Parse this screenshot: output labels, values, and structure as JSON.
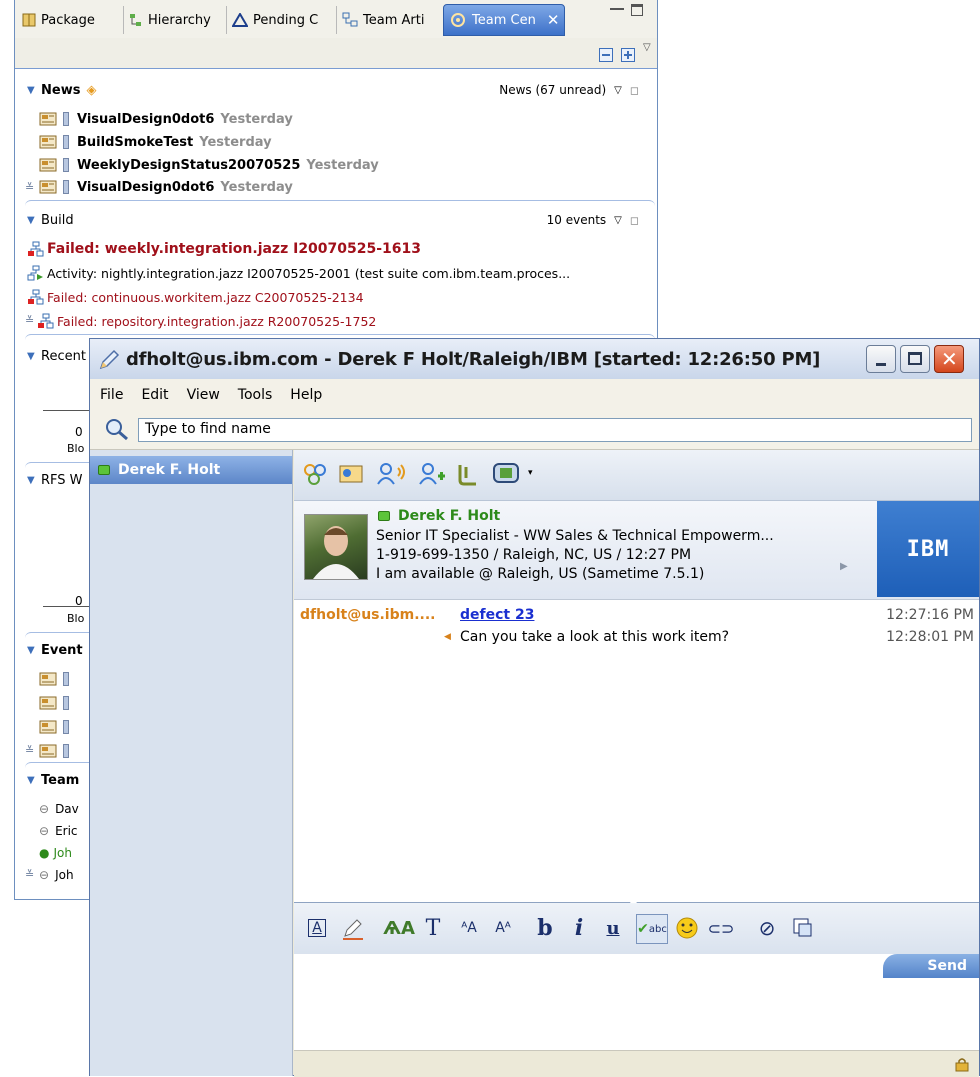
{
  "eclipse": {
    "tabs": [
      {
        "label": "Package"
      },
      {
        "label": "Hierarchy"
      },
      {
        "label": "Pending C"
      },
      {
        "label": "Team Arti"
      },
      {
        "label": "Team Cen",
        "active": true
      }
    ],
    "news": {
      "title": "News",
      "summary": "News (67 unread)",
      "items": [
        {
          "title": "VisualDesign0dot6",
          "when": "Yesterday"
        },
        {
          "title": "BuildSmokeTest",
          "when": "Yesterday"
        },
        {
          "title": "WeeklyDesignStatus20070525",
          "when": "Yesterday"
        },
        {
          "title": "VisualDesign0dot6",
          "when": "Yesterday"
        }
      ]
    },
    "build": {
      "title": "Build",
      "summary": "10 events",
      "items": [
        {
          "text": "Failed: weekly.integration.jazz I20070525-1613",
          "status": "failed",
          "bold": true
        },
        {
          "text": "Activity: nightly.integration.jazz I20070525-2001 (test suite com.ibm.team.proces...",
          "status": "activity"
        },
        {
          "text": "Failed: continuous.workitem.jazz C20070525-2134",
          "status": "failed"
        },
        {
          "text": "Failed: repository.integration.jazz R20070525-1752",
          "status": "failed"
        }
      ]
    },
    "recent": {
      "title": "Recent",
      "tick": "0",
      "axis": "Blo"
    },
    "rfs": {
      "title": "RFS W",
      "tick": "0",
      "axis": "Blo"
    },
    "events": {
      "title": "Event"
    },
    "team": {
      "title": "Team",
      "members": [
        "Dav",
        "Eric",
        "Joh",
        "Joh"
      ]
    }
  },
  "sametime": {
    "window_title": "dfholt@us.ibm.com - Derek F Holt/Raleigh/IBM [started: 12:26:50 PM]",
    "menu": [
      "File",
      "Edit",
      "View",
      "Tools",
      "Help"
    ],
    "search_placeholder": "Type to find name",
    "contact": "Derek F. Holt",
    "card": {
      "name": "Derek F. Holt",
      "title": "Senior IT Specialist - WW Sales & Technical Empowerm...",
      "phone": "1-919-699-1350 / Raleigh, NC, US / 12:27 PM",
      "status": "I am available @ Raleigh, US (Sametime 7.5.1)",
      "logo": "IBM"
    },
    "transcript": [
      {
        "sender": "dfholt@us.ibm....",
        "text": "defect 23",
        "link": true,
        "time": "12:27:16 PM"
      },
      {
        "sender": "",
        "text": "Can you take a look at this work item?",
        "link": false,
        "time": "12:28:01 PM"
      }
    ],
    "send_label": "Send",
    "colors": {
      "accent": "#3f78c9",
      "failed": "#a0101a",
      "sender": "#d8821b",
      "online": "#2d8a1a"
    }
  }
}
